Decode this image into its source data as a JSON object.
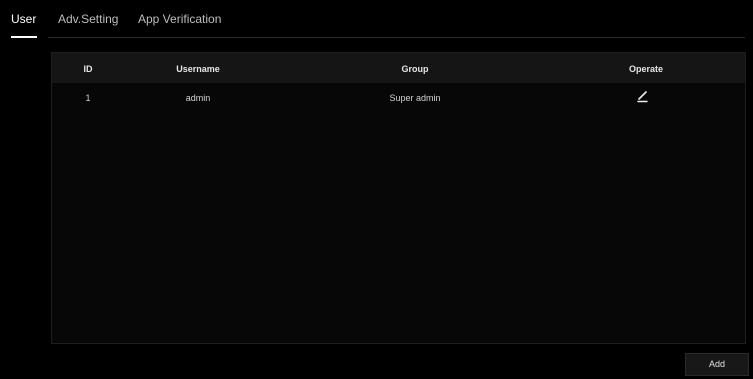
{
  "tabs": [
    {
      "label": "User",
      "active": true
    },
    {
      "label": "Adv.Setting",
      "active": false
    },
    {
      "label": "App Verification",
      "active": false
    }
  ],
  "table": {
    "columns": [
      "ID",
      "Username",
      "Group",
      "Operate"
    ],
    "rows": [
      {
        "id": "1",
        "username": "admin",
        "group": "Super admin",
        "operate_icon": "edit-pencil-icon"
      }
    ]
  },
  "footer": {
    "add_label": "Add"
  },
  "colors": {
    "background": "#000000",
    "panel": "#070707",
    "header": "#151515",
    "active_tab": "#ffffff",
    "inactive_tab": "#bdbdbd"
  }
}
